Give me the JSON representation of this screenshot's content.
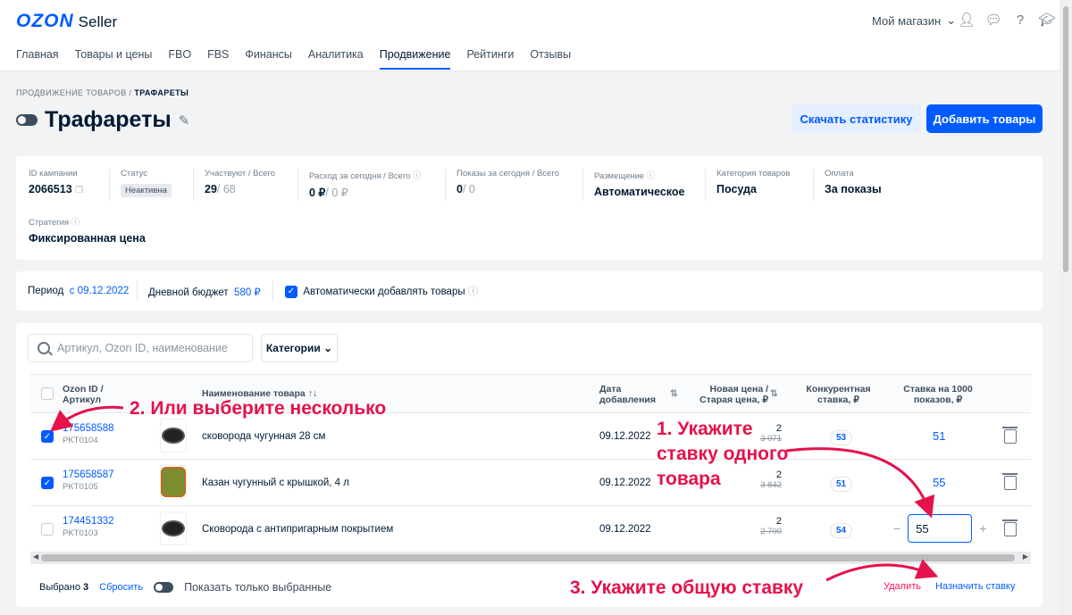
{
  "header": {
    "logo_main": "OZON",
    "logo_sub": "Seller",
    "shop_name": "Мой магазин",
    "nav": [
      "Главная",
      "Товары и цены",
      "FBO",
      "FBS",
      "Финансы",
      "Аналитика",
      "Продвижение",
      "Рейтинги",
      "Отзывы"
    ],
    "active_nav": "Продвижение"
  },
  "breadcrumb": {
    "parent": "ПРОДВИЖЕНИЕ ТОВАРОВ",
    "sep": "/",
    "current": "ТРАФАРЕТЫ"
  },
  "page": {
    "title": "Трафареты",
    "download_label": "Скачать статистику",
    "add_label": "Добавить товары"
  },
  "campaign": {
    "id_label": "ID кампании",
    "id_value": "2066513",
    "status_label": "Статус",
    "status_value": "Неактивна",
    "participants_label": "Участвуют / Всего",
    "participants_value": "29",
    "participants_total": "/ 68",
    "spend_label": "Расход за сегодня / Всего",
    "spend_value": "0 ₽",
    "spend_total": "/ 0 ₽",
    "views_label": "Показы за сегодня / Всего",
    "views_value": "0",
    "views_total": "/ 0",
    "placement_label": "Размещение",
    "placement_value": "Автоматическое",
    "category_label": "Категория товаров",
    "category_value": "Посуда",
    "payment_label": "Оплата",
    "payment_value": "За показы",
    "strategy_label": "Стратегия",
    "strategy_value": "Фиксированная цена"
  },
  "period": {
    "period_label": "Период",
    "period_value": "с 09.12.2022",
    "budget_label": "Дневной бюджет",
    "budget_value": "580 ₽",
    "auto_add_label": "Автоматически добавлять товары",
    "auto_add_checked": true
  },
  "table": {
    "search_placeholder": "Артикул, Ozon ID, наименование",
    "categories_label": "Категории",
    "headers": {
      "id": "Ozon ID / Артикул",
      "name": "Наименование товара ↑↓",
      "date": "Дата добавления",
      "price": "Новая цена / Старая цена, ₽",
      "competitive": "Конкурентная ставка, ₽",
      "bid": "Ставка на 1000 показов, ₽"
    },
    "rows": [
      {
        "id": "175658588",
        "sku": "PKT0104",
        "name": "сковорода чугунная 28 см",
        "date": "09.12.2022",
        "price_new": "2",
        "price_old": "3 071",
        "competitive": "53",
        "bid": "51",
        "checked": true
      },
      {
        "id": "175658587",
        "sku": "PKT0105",
        "name": "Казан чугунный с крышкой, 4 л",
        "date": "09.12.2022",
        "price_new": "2",
        "price_old": "3 842",
        "competitive": "51",
        "bid": "55",
        "checked": true
      },
      {
        "id": "174451332",
        "sku": "PKT0103",
        "name": "Сковорода с антипригарным покрытием",
        "date": "09.12.2022",
        "price_new": "2",
        "price_old": "2 700",
        "competitive": "54",
        "bid_input": "55",
        "checked": false
      }
    ]
  },
  "footer": {
    "selected_label": "Выбрано",
    "selected_count": "3",
    "reset_label": "Сбросить",
    "show_selected_label": "Показать только выбранные",
    "delete_label": "Удалить",
    "assign_label": "Назначить ставку"
  },
  "annotations": {
    "a1_line1": "1. Укажите",
    "a1_line2": "ставку одного",
    "a1_line3": "товара",
    "a2": "2. Или выберите несколько",
    "a3": "3. Укажите общую ставку",
    "color": "#e5124b"
  }
}
